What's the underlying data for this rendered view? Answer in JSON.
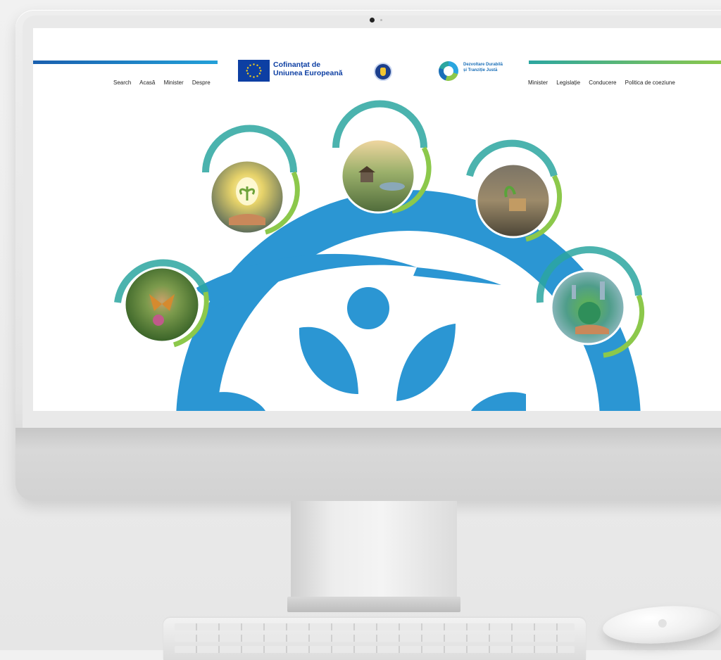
{
  "header": {
    "nav_left": [
      "Search",
      "Acasă",
      "Minister",
      "Despre"
    ],
    "nav_right": [
      "Minister",
      "Legislație",
      "Conducere",
      "Politica de coeziune"
    ],
    "eu_logo": {
      "line1": "Cofinanțat de",
      "line2": "Uniunea Europeană"
    },
    "program_logo": {
      "line1": "Dezvoltare Durabilă",
      "line2": "și Tranziție Justă"
    }
  },
  "hero": {
    "circle_images": [
      {
        "icon": "butterfly-photo"
      },
      {
        "icon": "lightbulb-plant-photo"
      },
      {
        "icon": "village-landscape-photo"
      },
      {
        "icon": "waste-recycling-photo"
      },
      {
        "icon": "green-globe-city-photo"
      }
    ]
  },
  "colors": {
    "accent_blue": "#2b96d3",
    "green": "#8cc84b",
    "teal": "#2ca6a0",
    "eu_blue": "#0d3fa3"
  }
}
